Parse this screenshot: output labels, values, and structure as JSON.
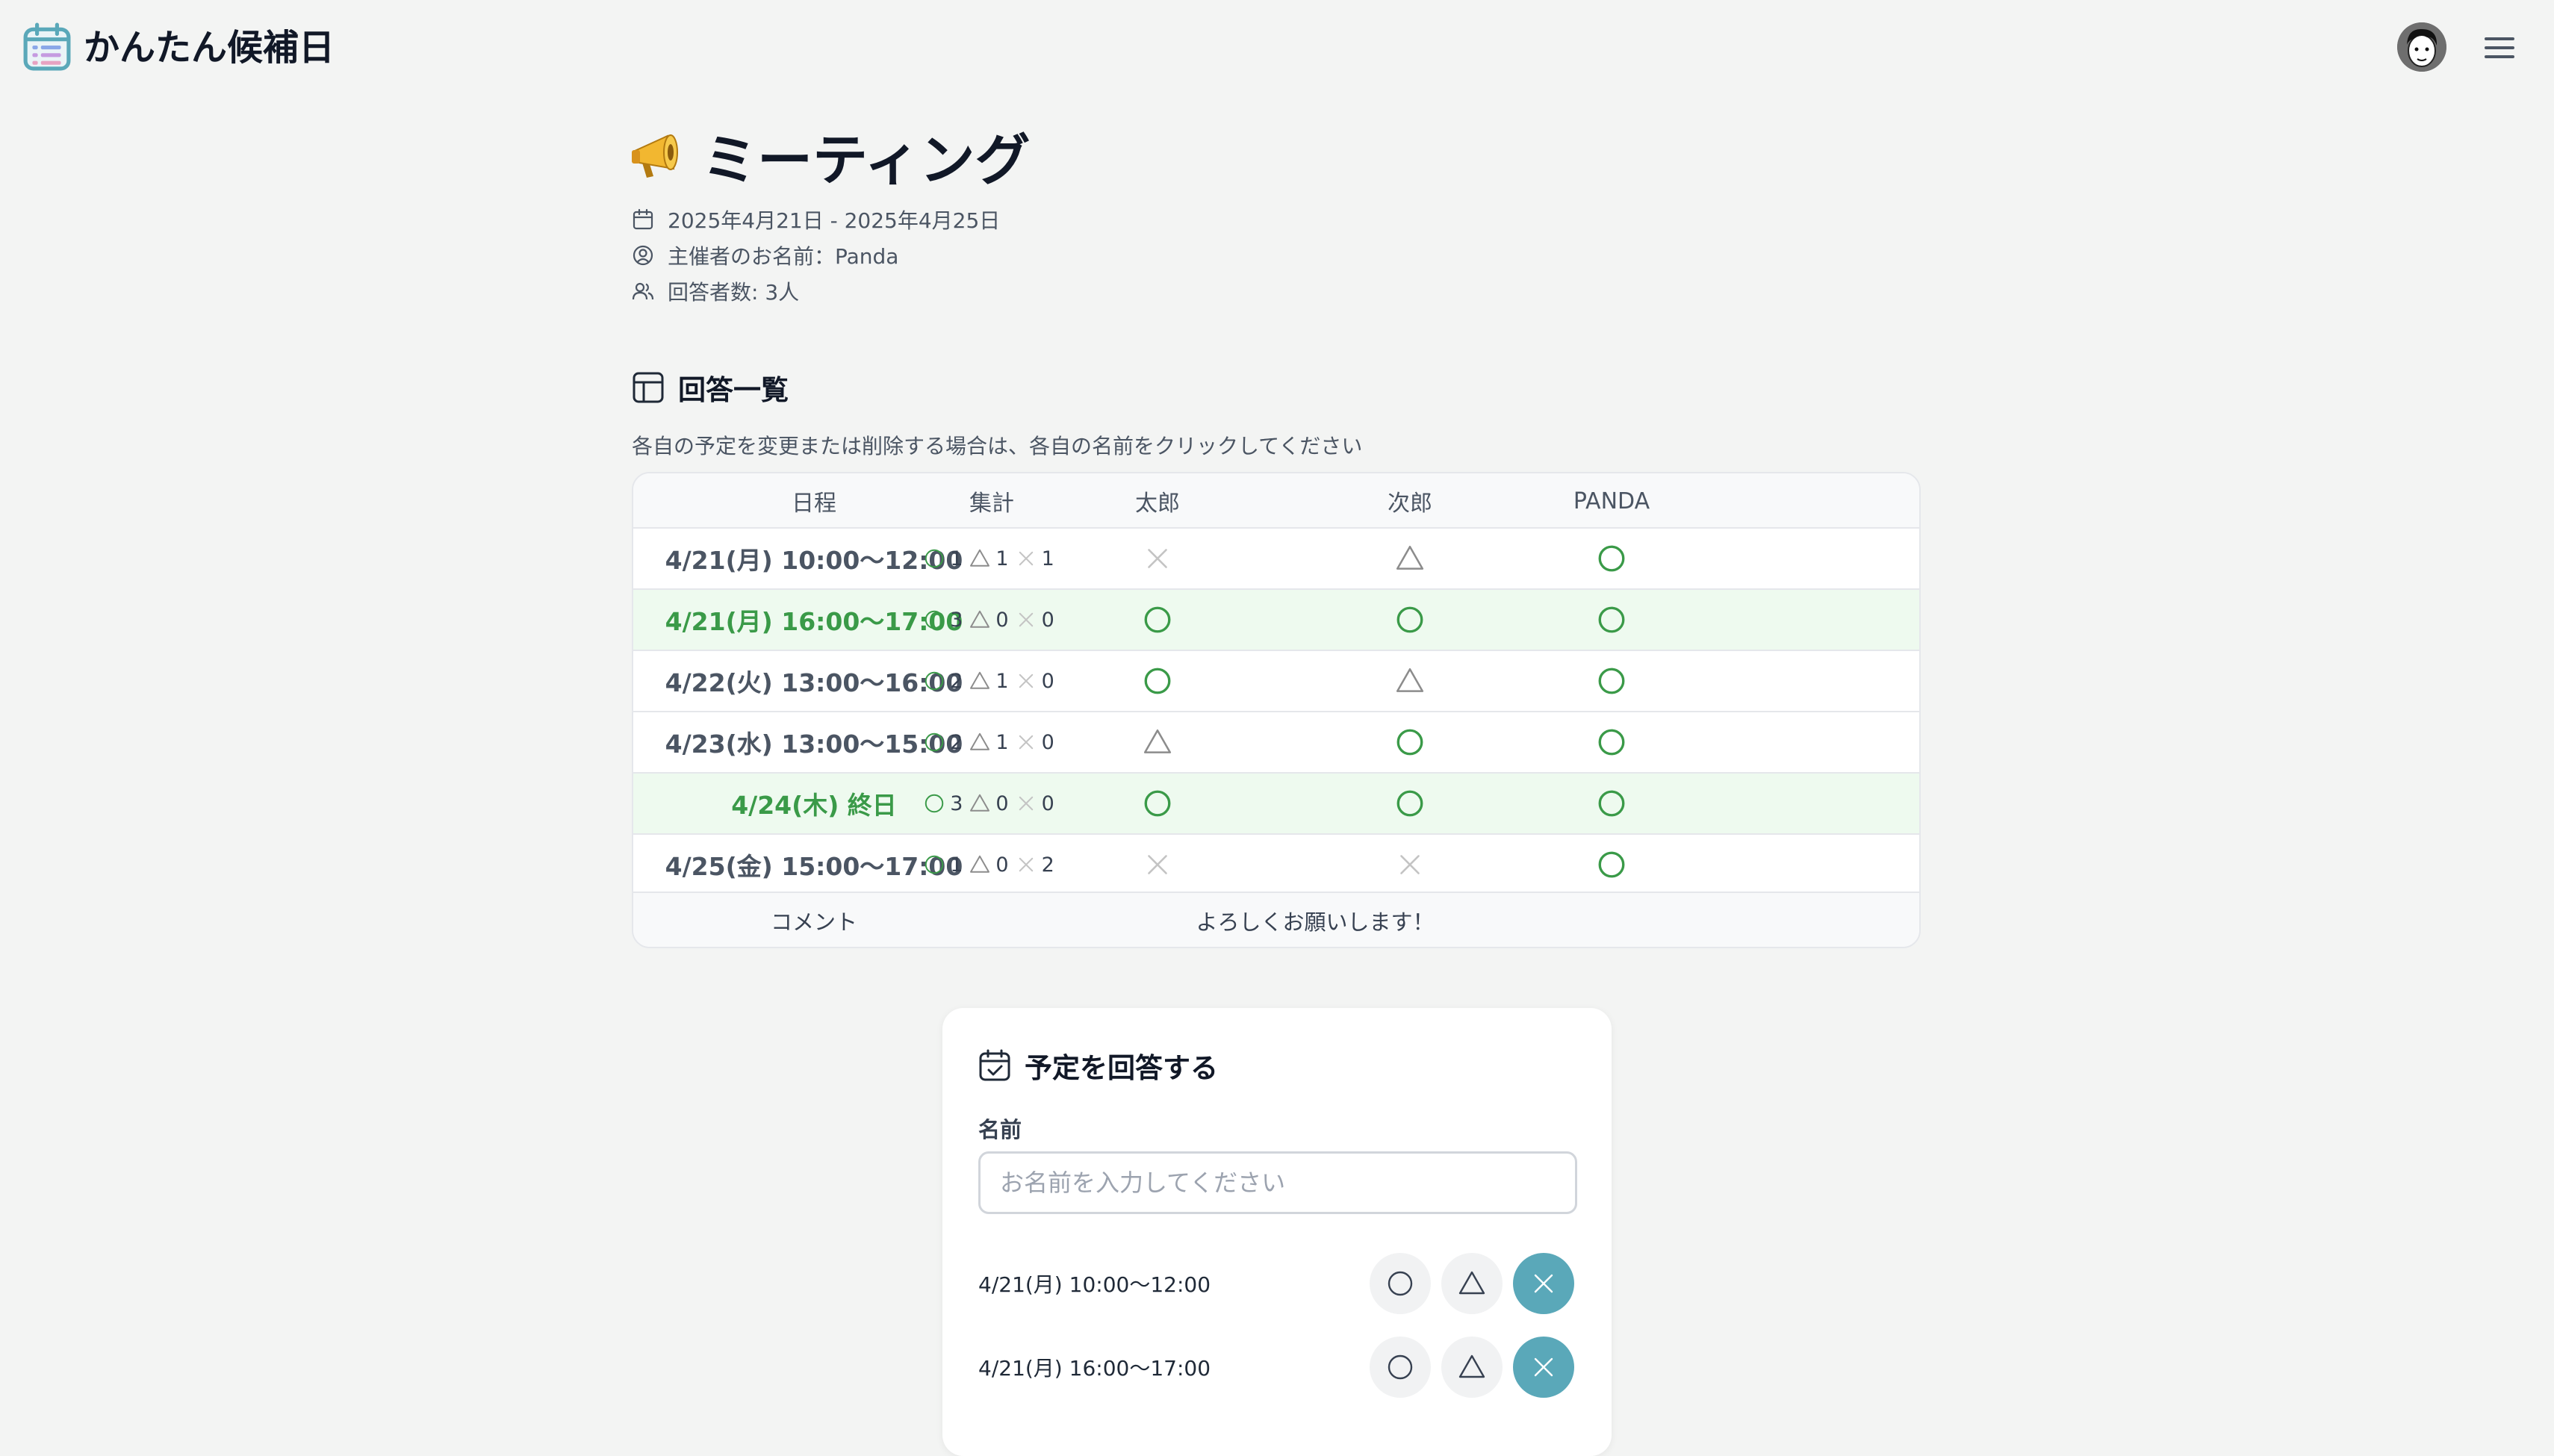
{
  "app": {
    "title": "かんたん候補日"
  },
  "event": {
    "icon": "megaphone-icon",
    "title": "ミーティング",
    "date_range": "2025年4月21日 - 2025年4月25日",
    "organizer": "主催者のお名前：Panda",
    "respondents": "回答者数: 3人"
  },
  "results": {
    "heading": "回答一覧",
    "hint": "各自の予定を変更または削除する場合は、各自の名前をクリックしてください",
    "columns": [
      "日程",
      "集計",
      "太郎",
      "次郎",
      "PANDA"
    ],
    "rows": [
      {
        "date": "4/21(月) 10:00〜12:00",
        "counts": [
          "1",
          "1",
          "1"
        ],
        "answers": [
          "×",
          "△",
          "○"
        ],
        "best": false
      },
      {
        "date": "4/21(月) 16:00〜17:00",
        "counts": [
          "3",
          "0",
          "0"
        ],
        "answers": [
          "○",
          "○",
          "○"
        ],
        "best": true
      },
      {
        "date": "4/22(火) 13:00〜16:00",
        "counts": [
          "2",
          "1",
          "0"
        ],
        "answers": [
          "○",
          "△",
          "○"
        ],
        "best": false
      },
      {
        "date": "4/23(水) 13:00〜15:00",
        "counts": [
          "2",
          "1",
          "0"
        ],
        "answers": [
          "△",
          "○",
          "○"
        ],
        "best": false
      },
      {
        "date": "4/24(木) 終日",
        "counts": [
          "3",
          "0",
          "0"
        ],
        "answers": [
          "○",
          "○",
          "○"
        ],
        "best": true
      },
      {
        "date": "4/25(金) 15:00〜17:00",
        "counts": [
          "1",
          "0",
          "2"
        ],
        "answers": [
          "×",
          "×",
          "○"
        ],
        "best": false
      }
    ],
    "comment_label": "コメント",
    "comment": "よろしくお願いします！"
  },
  "form": {
    "heading": "予定を回答する",
    "name_label": "名前",
    "name_placeholder": "お名前を入力してください",
    "name_value": "",
    "items": [
      {
        "date": "4/21(月) 10:00〜12:00",
        "selected": "×"
      },
      {
        "date": "4/21(月) 16:00〜17:00",
        "selected": "×"
      }
    ]
  },
  "colors": {
    "ok": "#3a9a48",
    "maybe": "#8c8c8c",
    "ng": "#c4c4c4",
    "best_row": "#eefaef",
    "selected_button": "#5aa8b9"
  }
}
